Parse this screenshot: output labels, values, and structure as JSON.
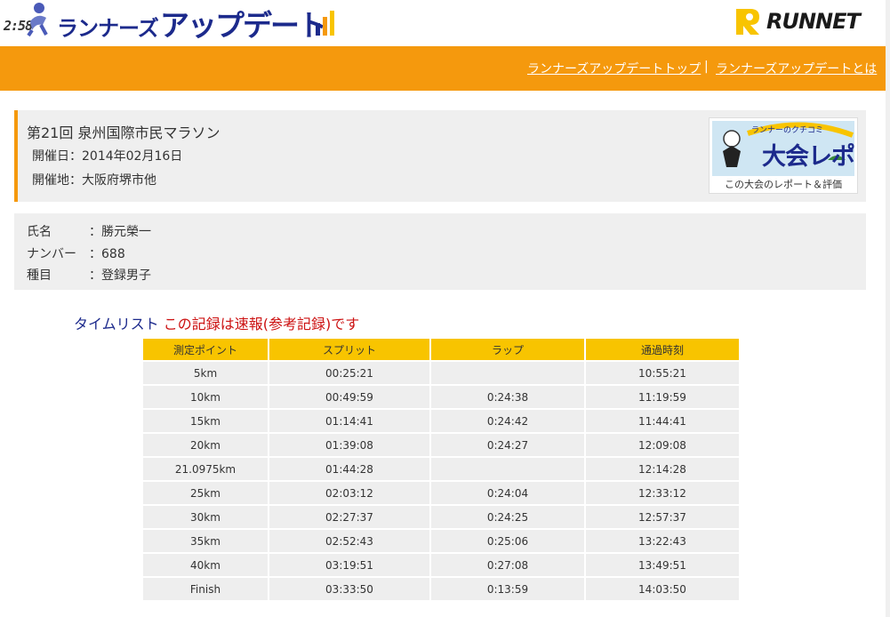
{
  "header": {
    "clock": "2:58",
    "title_kana": "ランナーズ",
    "title_big": "アップデート",
    "runnet_logo": "RUNNET"
  },
  "nav": {
    "links": [
      {
        "label": "ランナーズアップデートトップ"
      },
      {
        "label": "ランナーズアップデートとは"
      }
    ],
    "separator": "|"
  },
  "race": {
    "name": "第21回 泉州国際市民マラソン",
    "date": "開催日：2014年02月16日",
    "place": "開催地：大阪府堺市他",
    "banner": {
      "small_text": "ランナーのクチコミ",
      "big_text": "大会レポ",
      "caption": "この大会のレポート＆評価"
    }
  },
  "runner": {
    "rows": [
      {
        "label": "氏名",
        "value": "：勝元榮一"
      },
      {
        "label": "ナンバー",
        "value": "：688"
      },
      {
        "label": "種目",
        "value": "：登録男子"
      }
    ]
  },
  "timelist": {
    "label": "タイムリスト",
    "note": "この記録は速報(参考記録)です",
    "columns": [
      "測定ポイント",
      "スプリット",
      "ラップ",
      "通過時刻"
    ],
    "rows": [
      [
        "5km",
        "00:25:21",
        "",
        "10:55:21"
      ],
      [
        "10km",
        "00:49:59",
        "0:24:38",
        "11:19:59"
      ],
      [
        "15km",
        "01:14:41",
        "0:24:42",
        "11:44:41"
      ],
      [
        "20km",
        "01:39:08",
        "0:24:27",
        "12:09:08"
      ],
      [
        "21.0975km",
        "01:44:28",
        "",
        "12:14:28"
      ],
      [
        "25km",
        "02:03:12",
        "0:24:04",
        "12:33:12"
      ],
      [
        "30km",
        "02:27:37",
        "0:24:25",
        "12:57:37"
      ],
      [
        "35km",
        "02:52:43",
        "0:25:06",
        "13:22:43"
      ],
      [
        "40km",
        "03:19:51",
        "0:27:08",
        "13:49:51"
      ],
      [
        "Finish",
        "03:33:50",
        "0:13:59",
        "14:03:50"
      ]
    ]
  },
  "colors": {
    "accent_orange": "#f5990d",
    "header_yellow": "#f8c400",
    "title_navy": "#1c2a8c",
    "note_red": "#cc1111",
    "panel_gray": "#efefef"
  }
}
